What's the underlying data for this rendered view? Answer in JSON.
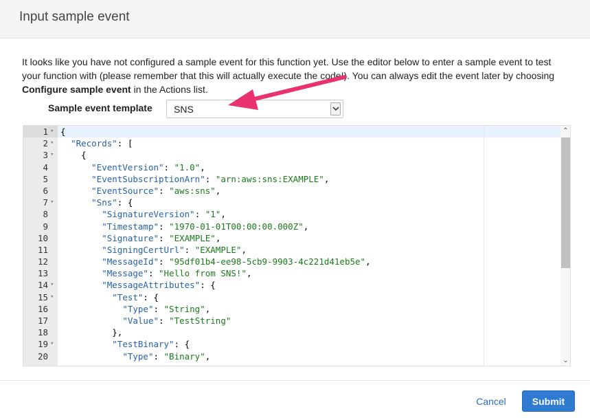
{
  "dialog": {
    "title": "Input sample event",
    "description_part1": "It looks like you have not configured a sample event for this function yet. Use the editor below to enter a sample event to test your function with (please remember that this will actually execute the code!). You can always edit the event later by choosing ",
    "description_bold": "Configure sample event",
    "description_part2": " in the Actions list."
  },
  "template": {
    "label": "Sample event template",
    "selected": "SNS"
  },
  "editor": {
    "lines": [
      {
        "n": "1",
        "fold": true,
        "text": "{"
      },
      {
        "n": "2",
        "fold": true,
        "text": "  \"Records\": ["
      },
      {
        "n": "3",
        "fold": true,
        "text": "    {"
      },
      {
        "n": "4",
        "fold": false,
        "text": "      \"EventVersion\": \"1.0\","
      },
      {
        "n": "5",
        "fold": false,
        "text": "      \"EventSubscriptionArn\": \"arn:aws:sns:EXAMPLE\","
      },
      {
        "n": "6",
        "fold": false,
        "text": "      \"EventSource\": \"aws:sns\","
      },
      {
        "n": "7",
        "fold": true,
        "text": "      \"Sns\": {"
      },
      {
        "n": "8",
        "fold": false,
        "text": "        \"SignatureVersion\": \"1\","
      },
      {
        "n": "9",
        "fold": false,
        "text": "        \"Timestamp\": \"1970-01-01T00:00:00.000Z\","
      },
      {
        "n": "10",
        "fold": false,
        "text": "        \"Signature\": \"EXAMPLE\","
      },
      {
        "n": "11",
        "fold": false,
        "text": "        \"SigningCertUrl\": \"EXAMPLE\","
      },
      {
        "n": "12",
        "fold": false,
        "text": "        \"MessageId\": \"95df01b4-ee98-5cb9-9903-4c221d41eb5e\","
      },
      {
        "n": "13",
        "fold": false,
        "text": "        \"Message\": \"Hello from SNS!\","
      },
      {
        "n": "14",
        "fold": true,
        "text": "        \"MessageAttributes\": {"
      },
      {
        "n": "15",
        "fold": true,
        "text": "          \"Test\": {"
      },
      {
        "n": "16",
        "fold": false,
        "text": "            \"Type\": \"String\","
      },
      {
        "n": "17",
        "fold": false,
        "text": "            \"Value\": \"TestString\""
      },
      {
        "n": "18",
        "fold": false,
        "text": "          },"
      },
      {
        "n": "19",
        "fold": true,
        "text": "          \"TestBinary\": {"
      },
      {
        "n": "20",
        "fold": false,
        "text": "            \"Type\": \"Binary\","
      }
    ]
  },
  "buttons": {
    "cancel": "Cancel",
    "submit": "Submit"
  },
  "colors": {
    "accent": "#2e7bd1",
    "annotation_arrow": "#e8336e",
    "json_key": "#2561a8",
    "json_string": "#1a7a1a"
  },
  "icons": {
    "select_arrow": "chevron-down-icon",
    "annotation": "pointer-arrow-icon"
  }
}
